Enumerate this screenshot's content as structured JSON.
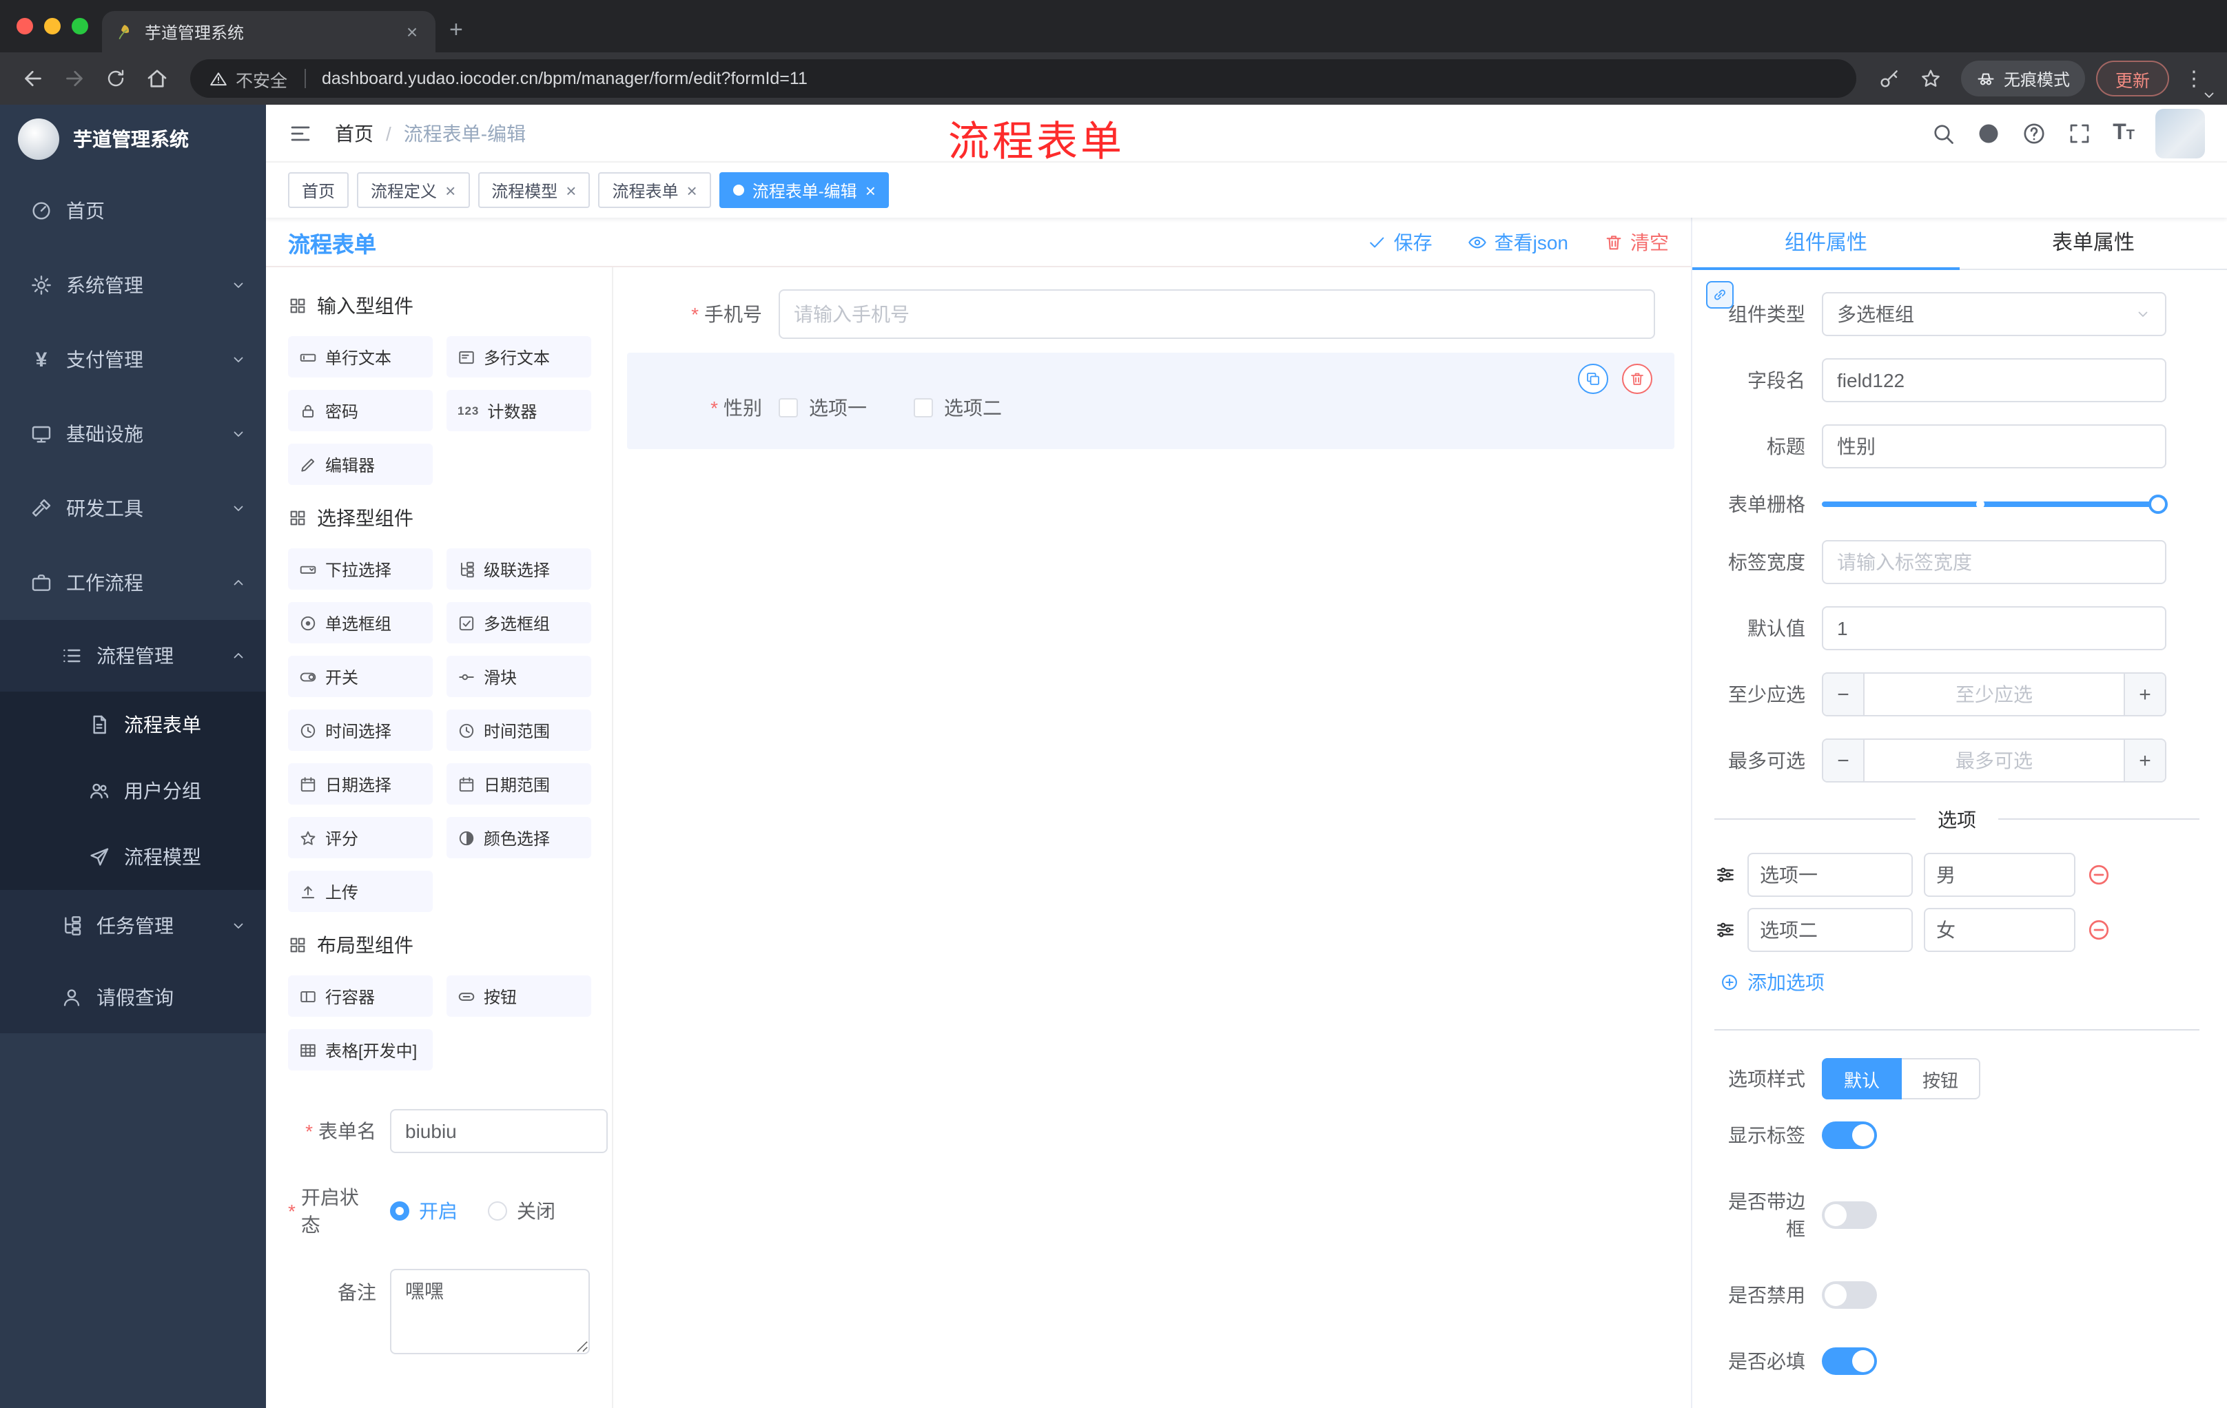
{
  "annotation": "流程表单",
  "browser": {
    "tab_title": "芋道管理系统",
    "security_label": "不安全",
    "url": "dashboard.yudao.iocoder.cn/bpm/manager/form/edit?formId=11",
    "incognito_label": "无痕模式",
    "update_label": "更新"
  },
  "sidebar": {
    "logo_title": "芋道管理系统",
    "items": [
      {
        "label": "首页"
      },
      {
        "label": "系统管理"
      },
      {
        "label": "支付管理"
      },
      {
        "label": "基础设施"
      },
      {
        "label": "研发工具"
      },
      {
        "label": "工作流程"
      },
      {
        "label": "流程管理"
      },
      {
        "label": "流程表单"
      },
      {
        "label": "用户分组"
      },
      {
        "label": "流程模型"
      },
      {
        "label": "任务管理"
      },
      {
        "label": "请假查询"
      }
    ]
  },
  "header": {
    "breadcrumb_home": "首页",
    "breadcrumb_separator": "/",
    "breadcrumb_current": "流程表单-编辑"
  },
  "tags": [
    {
      "label": "首页"
    },
    {
      "label": "流程定义"
    },
    {
      "label": "流程模型"
    },
    {
      "label": "流程表单"
    },
    {
      "label": "流程表单-编辑"
    }
  ],
  "designer": {
    "title": "流程表单",
    "save_label": "保存",
    "view_json_label": "查看json",
    "clear_label": "清空",
    "palette": {
      "sections": [
        {
          "title": "输入型组件",
          "items": [
            "单行文本",
            "多行文本",
            "密码",
            "计数器",
            "编辑器"
          ]
        },
        {
          "title": "选择型组件",
          "items": [
            "下拉选择",
            "级联选择",
            "单选框组",
            "多选框组",
            "开关",
            "滑块",
            "时间选择",
            "时间范围",
            "日期选择",
            "日期范围",
            "评分",
            "颜色选择",
            "上传"
          ]
        },
        {
          "title": "布局型组件",
          "items": [
            "行容器",
            "按钮",
            "表格[开发中]"
          ]
        }
      ]
    },
    "meta": {
      "form_name_label": "表单名",
      "form_name_value": "biubiu",
      "status_label": "开启状态",
      "status_on": "开启",
      "status_off": "关闭",
      "remark_label": "备注",
      "remark_value": "嘿嘿"
    }
  },
  "canvas": {
    "phone": {
      "label": "手机号",
      "placeholder": "请输入手机号"
    },
    "gender": {
      "label": "性别",
      "option1": "选项一",
      "option2": "选项二"
    }
  },
  "props": {
    "tab_component": "组件属性",
    "tab_form": "表单属性",
    "component_type_label": "组件类型",
    "component_type_value": "多选框组",
    "field_name_label": "字段名",
    "field_name_value": "field122",
    "title_label": "标题",
    "title_value": "性别",
    "grid_label": "表单栅格",
    "label_width_label": "标签宽度",
    "label_width_placeholder": "请输入标签宽度",
    "default_label": "默认值",
    "default_value": "1",
    "min_label": "至少应选",
    "min_placeholder": "至少应选",
    "max_label": "最多可选",
    "max_placeholder": "最多可选",
    "options_title": "选项",
    "options": [
      {
        "label": "选项一",
        "value": "男"
      },
      {
        "label": "选项二",
        "value": "女"
      }
    ],
    "add_option_label": "添加选项",
    "option_style_label": "选项样式",
    "option_style_default": "默认",
    "option_style_button": "按钮",
    "switches": [
      {
        "label": "显示标签",
        "state": "on"
      },
      {
        "label": "是否带边框",
        "state": "off"
      },
      {
        "label": "是否禁用",
        "state": "off"
      },
      {
        "label": "是否必填",
        "state": "on"
      }
    ]
  },
  "colors": {
    "accent": "#409eff",
    "danger": "#f56c6c",
    "annotation_red": "#fd2b2b",
    "sidebar_bg": "#2d3a4e",
    "active_tag_bg": "#409eff"
  },
  "icons": {
    "browser": [
      "back",
      "forward",
      "reload",
      "home",
      "warning-triangle",
      "key",
      "star",
      "incognito-hat",
      "menu-dots"
    ],
    "header": [
      "collapse-menu",
      "search",
      "github",
      "question",
      "fullscreen",
      "font-size"
    ],
    "sidebar": [
      "dashboard",
      "gear",
      "yen",
      "monitor",
      "wrench",
      "briefcase",
      "list",
      "document",
      "users",
      "paper-plane",
      "tree",
      "user"
    ],
    "toolbar": [
      "check",
      "eye",
      "trash"
    ],
    "field_actions": [
      "copy",
      "trash"
    ],
    "misc": [
      "chevron-down",
      "chevron-up",
      "drag-sliders",
      "link",
      "minus-circle",
      "plus-circle"
    ]
  }
}
